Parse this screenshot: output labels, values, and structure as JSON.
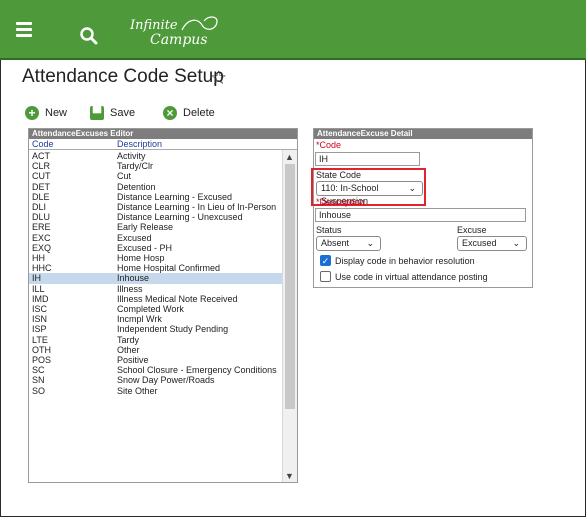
{
  "header": {
    "logo_line1": "Infinite",
    "logo_line2": "Campus"
  },
  "page": {
    "title": "Attendance Code Setup"
  },
  "toolbar": {
    "new_label": "New",
    "save_label": "Save",
    "delete_label": "Delete"
  },
  "editor": {
    "title": "AttendanceExcuses Editor",
    "col_code": "Code",
    "col_desc": "Description",
    "rows": [
      {
        "code": "ACT",
        "desc": "Activity"
      },
      {
        "code": "CLR",
        "desc": "Tardy/Clr"
      },
      {
        "code": "CUT",
        "desc": "Cut"
      },
      {
        "code": "DET",
        "desc": "Detention"
      },
      {
        "code": "DLE",
        "desc": "Distance Learning - Excused"
      },
      {
        "code": "DLI",
        "desc": "Distance Learning - In Lieu of In-Person"
      },
      {
        "code": "DLU",
        "desc": "Distance Learning - Unexcused"
      },
      {
        "code": "ERE",
        "desc": "Early Release"
      },
      {
        "code": "EXC",
        "desc": "Excused"
      },
      {
        "code": "EXQ",
        "desc": "Excused - PH"
      },
      {
        "code": "HH",
        "desc": "Home Hosp"
      },
      {
        "code": "HHC",
        "desc": "Home Hospital Confirmed"
      },
      {
        "code": "IH",
        "desc": "Inhouse"
      },
      {
        "code": "ILL",
        "desc": "Illness"
      },
      {
        "code": "IMD",
        "desc": "Illness Medical Note Received"
      },
      {
        "code": "ISC",
        "desc": "Completed Work"
      },
      {
        "code": "ISN",
        "desc": "Incmpl Wrk"
      },
      {
        "code": "ISP",
        "desc": "Independent Study Pending"
      },
      {
        "code": "LTE",
        "desc": "Tardy"
      },
      {
        "code": "OTH",
        "desc": "Other"
      },
      {
        "code": "POS",
        "desc": "Positive"
      },
      {
        "code": "SC",
        "desc": "School Closure - Emergency Conditions"
      },
      {
        "code": "SN",
        "desc": "Snow Day Power/Roads"
      },
      {
        "code": "SO",
        "desc": "Site Other"
      }
    ],
    "selected_code": "IH"
  },
  "detail": {
    "title": "AttendanceExcuse Detail",
    "code_label": "*Code",
    "code_value": "IH",
    "state_code_label": "State Code",
    "state_code_value": "110: In-School Suspension",
    "description_label": "*Description",
    "description_value": "Inhouse",
    "status_label": "Status",
    "status_value": "Absent",
    "excuse_label": "Excuse",
    "excuse_value": "Excused",
    "display_code_label": "Display code in behavior resolution",
    "display_code_checked": true,
    "virtual_label": "Use code in virtual attendance posting",
    "virtual_checked": false
  },
  "colors": {
    "header_green": "#4e9a3a",
    "highlight_red": "#e0242e",
    "selected_row": "#c5d8ec"
  }
}
